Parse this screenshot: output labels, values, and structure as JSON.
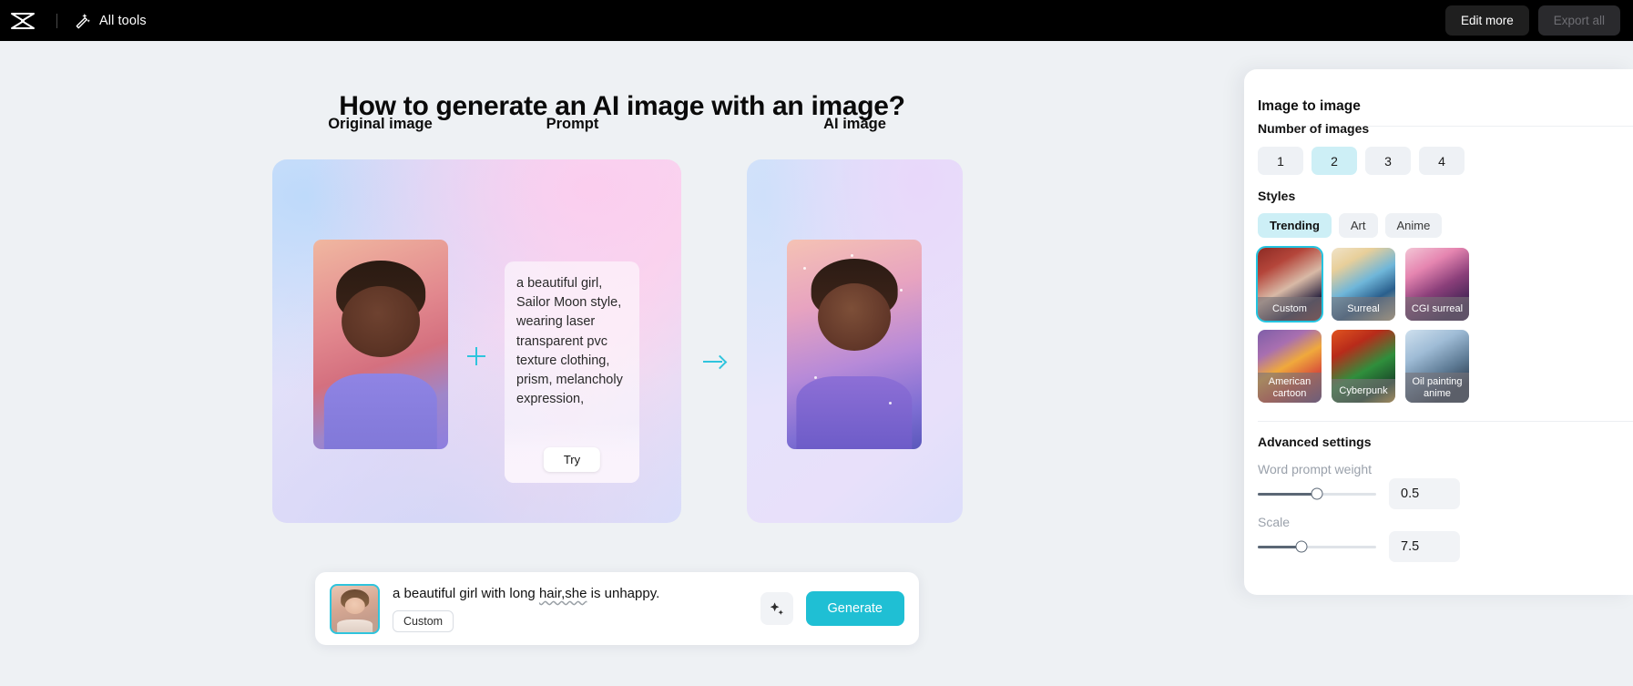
{
  "topbar": {
    "logo_icon": "capcut-logo-icon",
    "all_tools_icon": "magic-wand-icon",
    "all_tools_label": "All tools",
    "edit_more_label": "Edit more",
    "export_all_label": "Export all"
  },
  "main": {
    "page_title": "How to generate an AI image with an image?",
    "demo": {
      "original_heading": "Original image",
      "prompt_heading": "Prompt",
      "prompt_text": "a beautiful girl, Sailor Moon style, wearing laser transparent pvc texture clothing, prism, melancholy expression,",
      "try_label": "Try",
      "plus_icon": "plus-icon",
      "arrow_icon": "arrow-right-icon"
    },
    "result": {
      "ai_heading": "AI image"
    }
  },
  "bottom_bar": {
    "thumbnail_icon": "source-image-thumbnail",
    "prompt_value": "a beautiful girl with long hair,she is unhappy.",
    "prompt_misspelled": "hair,she",
    "prompt_before": "a beautiful girl with long ",
    "prompt_after": " is unhappy.",
    "style_chip_label": "Custom",
    "magic_icon": "sparkle-icon",
    "generate_label": "Generate"
  },
  "right_panel": {
    "title": "Image to image",
    "number_of_images": {
      "label": "Number of images",
      "options": [
        "1",
        "2",
        "3",
        "4"
      ],
      "selected": "2"
    },
    "styles": {
      "label": "Styles",
      "tabs": [
        {
          "label": "Trending",
          "active": true
        },
        {
          "label": "Art",
          "active": false
        },
        {
          "label": "Anime",
          "active": false
        }
      ],
      "cards": [
        {
          "name": "Custom",
          "selected": true,
          "thumb": "th-custom"
        },
        {
          "name": "Surreal",
          "selected": false,
          "thumb": "th-surreal"
        },
        {
          "name": "CGI surreal",
          "selected": false,
          "thumb": "th-cgi"
        },
        {
          "name": "American cartoon",
          "selected": false,
          "thumb": "th-amcartoon"
        },
        {
          "name": "Cyberpunk",
          "selected": false,
          "thumb": "th-cyberpunk"
        },
        {
          "name": "Oil painting anime",
          "selected": false,
          "thumb": "th-oilanime"
        }
      ]
    },
    "advanced": {
      "label": "Advanced settings",
      "word_prompt_weight": {
        "label": "Word prompt weight",
        "value": "0.5",
        "percent": 50
      },
      "scale": {
        "label": "Scale",
        "value": "7.5",
        "percent": 37
      }
    }
  },
  "colors": {
    "accent": "#23c4e0",
    "generate_button": "#1fbfd4",
    "selected_chip": "#cdeff6",
    "topbar_bg": "#000000",
    "canvas_bg": "#eef1f4"
  }
}
